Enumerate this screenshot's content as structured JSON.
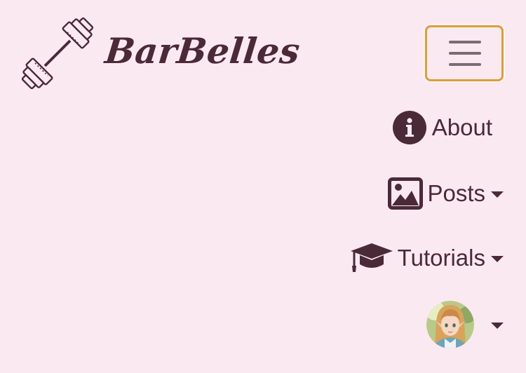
{
  "brand": {
    "name": "BarBelles",
    "logo_icon": "barbell-icon"
  },
  "toggler": {
    "icon": "hamburger-menu-icon",
    "border_color": "#d9a03a"
  },
  "nav": {
    "items": [
      {
        "label": "About",
        "icon": "info-circle-icon",
        "dropdown": false
      },
      {
        "label": "Posts",
        "icon": "image-icon",
        "dropdown": true
      },
      {
        "label": "Tutorials",
        "icon": "graduation-cap-icon",
        "dropdown": true
      },
      {
        "label": "",
        "icon": "user-avatar",
        "dropdown": true
      }
    ]
  },
  "colors": {
    "background": "#fbe9f1",
    "text": "#4b2a38",
    "accent": "#d9a03a"
  }
}
